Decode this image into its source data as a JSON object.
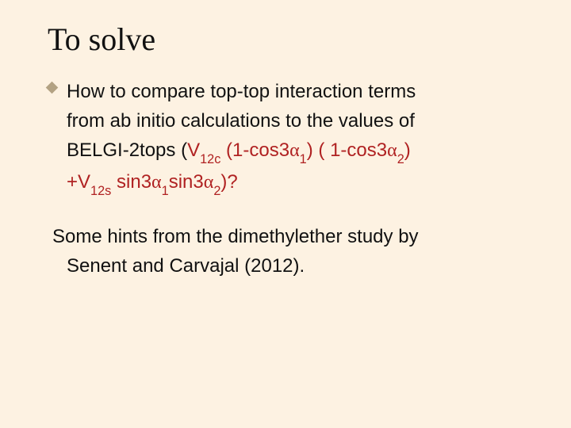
{
  "title": "To solve",
  "para1": {
    "line1": "How to compare top-top interaction terms",
    "line2": "from ab initio calculations to the values of",
    "line3_pre": "BELGI-2tops (",
    "V12c": "V",
    "V12c_sub": "12c",
    "seg_open1": " (1-cos3",
    "alpha": "α",
    "sub1": "1",
    "seg_close1": ") ( 1-cos3",
    "sub2": "2",
    "close_paren": ")",
    "line4_plus": "+V",
    "V12s_sub": "12s",
    "sin_seg1": " sin3",
    "sin_seg2": "sin3",
    "tail": ")?"
  },
  "para2": {
    "line1": "Some hints from the dimethylether study by",
    "line2": "Senent and Carvajal (2012)."
  }
}
